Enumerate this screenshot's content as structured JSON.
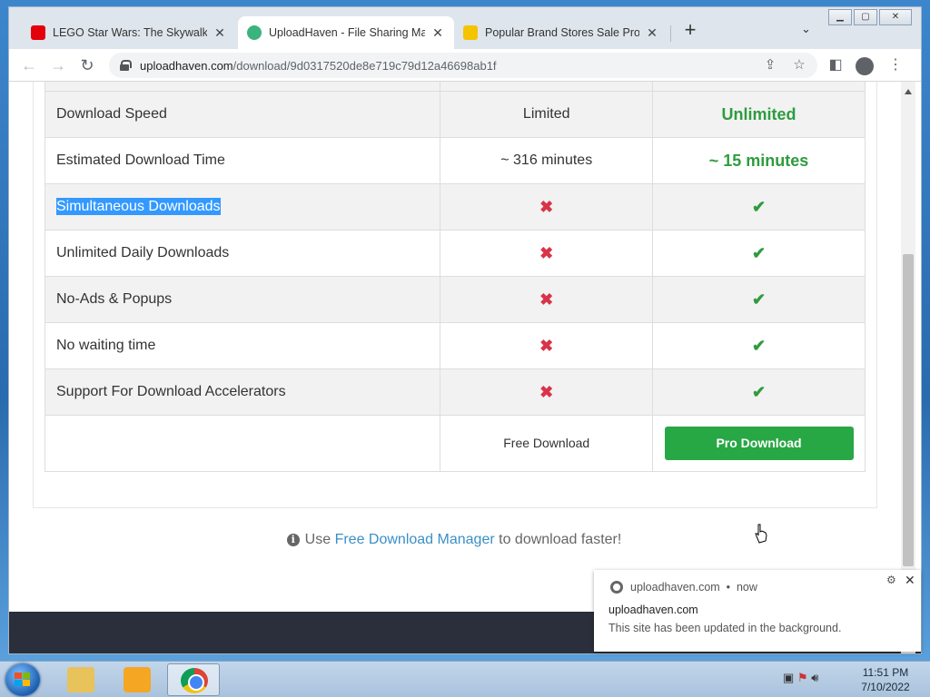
{
  "browser": {
    "tabs": [
      {
        "title": "LEGO Star Wars: The Skywalker S…",
        "active": false,
        "favicon_color": "#e3000b"
      },
      {
        "title": "UploadHaven - File Sharing Mad…",
        "active": true,
        "favicon_color": "#3bb37c"
      },
      {
        "title": "Popular Brand Stores Sale Promo…",
        "active": false,
        "favicon_color": "#f5c400"
      }
    ],
    "new_tab_label": "+",
    "url_host": "uploadhaven.com",
    "url_path": "/download/9d0317520de8e719c79d12a46698ab1f"
  },
  "table": {
    "rows": [
      {
        "feature": "Download Speed",
        "free": "Limited",
        "pro": "Unlimited"
      },
      {
        "feature": "Estimated Download Time",
        "free": "~ 316 minutes",
        "pro": "~ 15 minutes"
      },
      {
        "feature": "Simultaneous Downloads",
        "free": "✖",
        "pro": "✔"
      },
      {
        "feature": "Unlimited Daily Downloads",
        "free": "✖",
        "pro": "✔"
      },
      {
        "feature": "No-Ads & Popups",
        "free": "✖",
        "pro": "✔"
      },
      {
        "feature": "No waiting time",
        "free": "✖",
        "pro": "✔"
      },
      {
        "feature": "Support For Download Accelerators",
        "free": "✖",
        "pro": "✔"
      }
    ],
    "free_download_label": "Free Download",
    "pro_download_label": "Pro Download"
  },
  "tip": {
    "prefix": "Use",
    "link": "Free Download Manager",
    "suffix": "to download faster!"
  },
  "notification": {
    "source": "uploadhaven.com",
    "time": "now",
    "title": "uploadhaven.com",
    "message": "This site has been updated in the background."
  },
  "taskbar": {
    "time": "11:51 PM",
    "date": "7/10/2022"
  },
  "colors": {
    "accent_green": "#28a745",
    "cross_red": "#d9334a",
    "link_blue": "#3a8fc6"
  }
}
